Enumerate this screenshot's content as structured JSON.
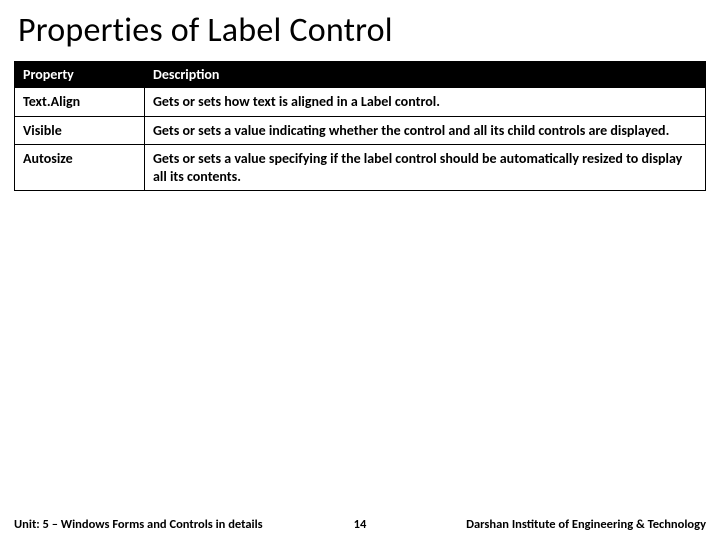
{
  "title": "Properties of Label Control",
  "table": {
    "headers": {
      "property": "Property",
      "description": "Description"
    },
    "rows": [
      {
        "property": "Text.Align",
        "description": "Gets or sets how text is aligned in a Label control."
      },
      {
        "property": "Visible",
        "description": "Gets or sets a value indicating whether the control and all its child controls are displayed."
      },
      {
        "property": "Autosize",
        "description": "Gets or sets a value specifying if the label control should be automatically resized to display all its contents."
      }
    ]
  },
  "footer": {
    "unit": "Unit: 5 – Windows Forms and Controls in details",
    "page": "14",
    "org": "Darshan Institute of Engineering & Technology"
  }
}
